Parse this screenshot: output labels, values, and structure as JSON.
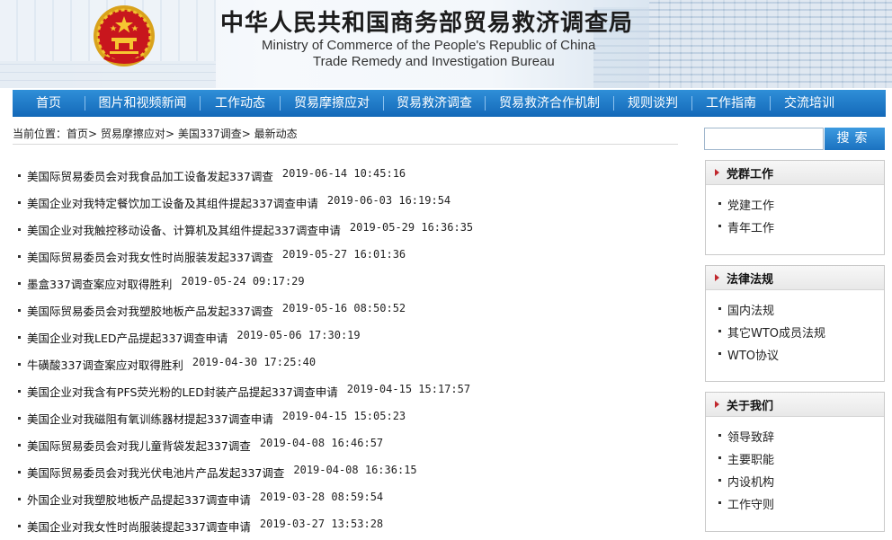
{
  "header": {
    "title_cn": "中华人民共和国商务部贸易救济调查局",
    "title_en_line1": "Ministry of Commerce of the People's Republic of China",
    "title_en_line2": "Trade Remedy and Investigation Bureau",
    "emblem_icon": "national-emblem-icon",
    "accent_color": "#1a6fbf"
  },
  "nav": {
    "items": [
      "首页",
      "图片和视频新闻",
      "工作动态",
      "贸易摩擦应对",
      "贸易救济调查",
      "贸易救济合作机制",
      "规则谈判",
      "工作指南",
      "交流培训"
    ]
  },
  "breadcrumb": {
    "prefix": "当前位置：",
    "crumbs": [
      "首页",
      "贸易摩擦应对",
      "美国337调查",
      "最新动态"
    ],
    "separator": ">"
  },
  "news": [
    {
      "title": "美国际贸易委员会对我食品加工设备发起337调查",
      "date": "2019-06-14 10:45:16"
    },
    {
      "title": "美国企业对我特定餐饮加工设备及其组件提起337调查申请",
      "date": "2019-06-03 16:19:54"
    },
    {
      "title": "美国企业对我触控移动设备、计算机及其组件提起337调查申请",
      "date": "2019-05-29 16:36:35"
    },
    {
      "title": "美国际贸易委员会对我女性时尚服装发起337调查",
      "date": "2019-05-27 16:01:36"
    },
    {
      "title": "墨盒337调查案应对取得胜利",
      "date": "2019-05-24 09:17:29"
    },
    {
      "title": "美国际贸易委员会对我塑胶地板产品发起337调查",
      "date": "2019-05-16 08:50:52"
    },
    {
      "title": "美国企业对我LED产品提起337调查申请",
      "date": "2019-05-06 17:30:19"
    },
    {
      "title": "牛磺酸337调查案应对取得胜利",
      "date": "2019-04-30 17:25:40"
    },
    {
      "title": "美国企业对我含有PFS荧光粉的LED封装产品提起337调查申请",
      "date": "2019-04-15 15:17:57"
    },
    {
      "title": "美国企业对我磁阻有氧训练器材提起337调查申请",
      "date": "2019-04-15 15:05:23"
    },
    {
      "title": "美国际贸易委员会对我儿童背袋发起337调查",
      "date": "2019-04-08 16:46:57"
    },
    {
      "title": "美国际贸易委员会对我光伏电池片产品发起337调查",
      "date": "2019-04-08 16:36:15"
    },
    {
      "title": "外国企业对我塑胶地板产品提起337调查申请",
      "date": "2019-03-28 08:59:54"
    },
    {
      "title": "美国企业对我女性时尚服装提起337调查申请",
      "date": "2019-03-27 13:53:28"
    }
  ],
  "search": {
    "value": "",
    "button_label": "搜索"
  },
  "sidebar": {
    "boxes": [
      {
        "title": "党群工作",
        "links": [
          "党建工作",
          "青年工作"
        ]
      },
      {
        "title": "法律法规",
        "links": [
          "国内法规",
          "其它WTO成员法规",
          "WTO协议"
        ]
      },
      {
        "title": "关于我们",
        "links": [
          "领导致辞",
          "主要职能",
          "内设机构",
          "工作守则"
        ]
      }
    ]
  }
}
